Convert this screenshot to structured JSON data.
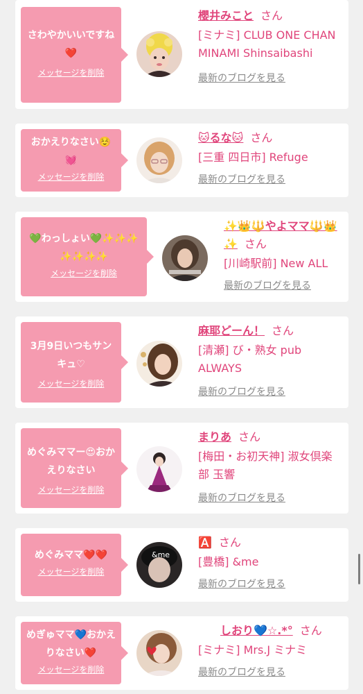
{
  "delete_label": "メッセージを削除",
  "blog_label": "最新のブログを見る",
  "san_label": "さん",
  "colors": {
    "bubble": "#f59bb0",
    "accent": "#e0457b",
    "link_gray": "#8a8a8a",
    "background": "#f0f0f0"
  },
  "entries": [
    {
      "message": "さわやかいいですね❤️",
      "name": "櫻井みこと",
      "shop": "[ミナミ] CLUB ONE CHAN MINAMI Shinsaibashi",
      "avatar_icon": "woman-photo-icon"
    },
    {
      "message": "おかえりなさい☺️💓",
      "name": "🐱るな🐱",
      "shop": "[三重 四日市] Refuge",
      "avatar_icon": "woman-photo-icon"
    },
    {
      "message": "💚わっしょい💚✨✨✨✨✨✨✨",
      "name": "✨👑🔱やよママ🔱👑✨",
      "shop": "[川崎駅前] New ALL",
      "avatar_icon": "woman-photo-icon"
    },
    {
      "message": "3月9日いつもサンキュ♡",
      "name": "麻耶どーん！",
      "shop": "[清瀬] び・熟女 pub ALWAYS",
      "avatar_icon": "woman-photo-icon"
    },
    {
      "message": "めぐみママー😍おかえりなさい",
      "name": "まりあ",
      "shop": "[梅田・お初天神] 淑女倶楽部 玉響",
      "avatar_icon": "woman-photo-icon"
    },
    {
      "message": "めぐみママ❤️❤️",
      "name": "🅰️",
      "shop": "[豊橋] &me",
      "avatar_icon": "woman-photo-icon"
    },
    {
      "message": "めぎゅママ💙おかえりなさい❤️",
      "name": "しおり💙☆.*°",
      "shop": "[ミナミ] Mrs.J ミナミ",
      "avatar_icon": "woman-photo-icon"
    }
  ]
}
